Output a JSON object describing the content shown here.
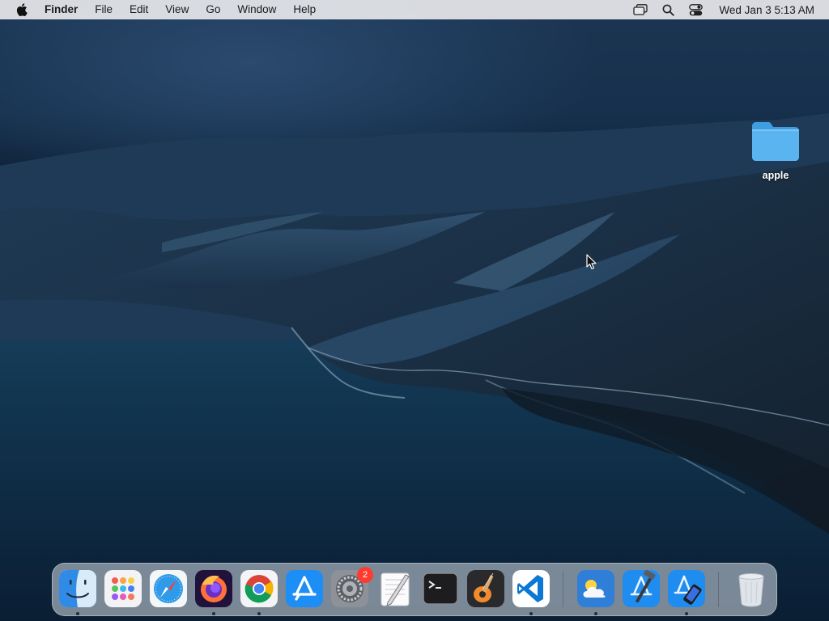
{
  "menubar": {
    "app_name": "Finder",
    "menus": [
      "File",
      "Edit",
      "View",
      "Go",
      "Window",
      "Help"
    ],
    "clock": "Wed Jan 3  5:13 AM",
    "status_icons": [
      "screen-mirroring-icon",
      "spotlight-search-icon",
      "control-center-icon"
    ]
  },
  "desktop": {
    "folder_label": "apple",
    "folder_color": "#5AB4F0"
  },
  "dock": {
    "apps": [
      {
        "name": "finder",
        "label": "Finder",
        "running": true
      },
      {
        "name": "launchpad",
        "label": "Launchpad",
        "running": false
      },
      {
        "name": "safari",
        "label": "Safari",
        "running": false
      },
      {
        "name": "firefox",
        "label": "Firefox",
        "running": true
      },
      {
        "name": "chrome",
        "label": "Google Chrome",
        "running": true
      },
      {
        "name": "app-store",
        "label": "App Store",
        "running": false
      },
      {
        "name": "system-preferences",
        "label": "System Preferences",
        "running": false,
        "badge": "2"
      },
      {
        "name": "textedit",
        "label": "TextEdit",
        "running": false
      },
      {
        "name": "terminal",
        "label": "Terminal",
        "running": false
      },
      {
        "name": "garageband",
        "label": "GarageBand",
        "running": false
      },
      {
        "name": "vscode",
        "label": "Visual Studio Code",
        "running": true
      },
      {
        "name": "weather",
        "label": "Weather",
        "running": true
      },
      {
        "name": "xcode",
        "label": "Xcode",
        "running": false
      },
      {
        "name": "simulator",
        "label": "Simulator",
        "running": true
      },
      {
        "name": "trash",
        "label": "Trash",
        "running": false
      }
    ],
    "accent": "#2b2b2b"
  }
}
